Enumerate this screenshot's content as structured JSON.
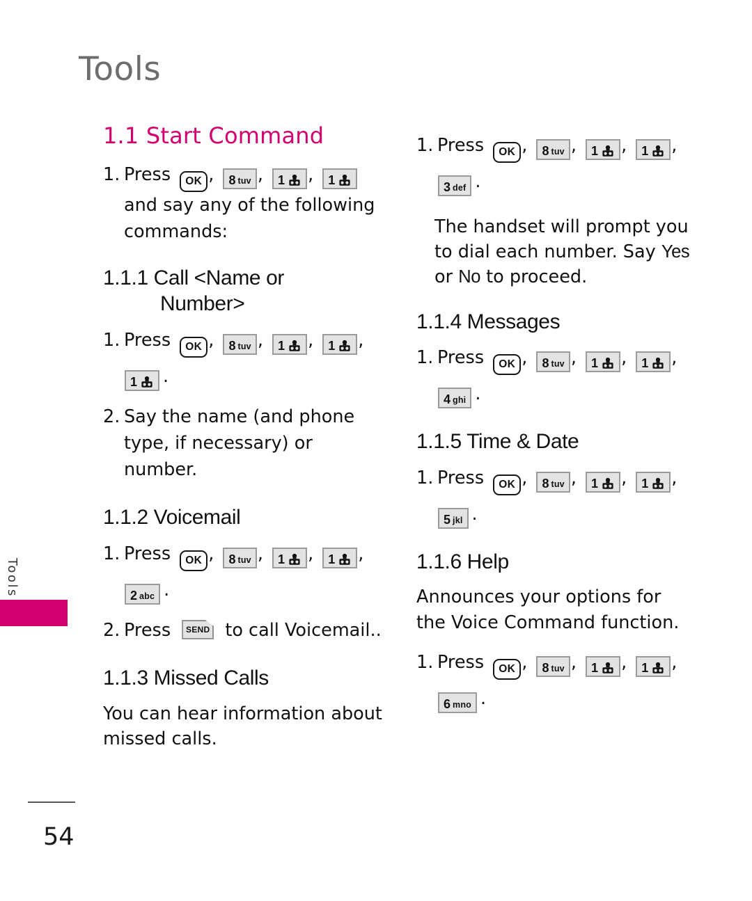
{
  "page": {
    "running_head": "Tools",
    "number": "54",
    "side_tab_label": "Tools",
    "accent_color": "#d2006e",
    "head_color": "#6d6d6d"
  },
  "keys": {
    "ok": {
      "label": "OK",
      "icon": "ok-key-icon"
    },
    "k1": {
      "digit": "1",
      "icon": "voicemail-glyph-icon"
    },
    "k2": {
      "digit": "2",
      "letters": "abc"
    },
    "k3": {
      "digit": "3",
      "letters": "def"
    },
    "k4": {
      "digit": "4",
      "letters": "ghi"
    },
    "k5": {
      "digit": "5",
      "letters": "jkl"
    },
    "k6": {
      "digit": "6",
      "letters": "mno"
    },
    "k8": {
      "digit": "8",
      "letters": "tuv"
    },
    "send": {
      "label": "SEND",
      "icon": "send-key-icon"
    }
  },
  "left_column": {
    "section_heading": "1.1 Start Command",
    "step1": {
      "num": "1.",
      "verb": "Press",
      "continuation": "and say any of the following commands:"
    },
    "sub_1_1_1": {
      "heading_line1": "1.1.1 Call <Name or",
      "heading_line2": "Number>",
      "step1_num": "1.",
      "step1_verb": "Press",
      "step2_num": "2.",
      "step2_text": "Say the name (and phone type, if necessary) or number."
    },
    "sub_1_1_2": {
      "heading": "1.1.2 Voicemail",
      "step1_num": "1.",
      "step1_verb": "Press",
      "step2_num": "2.",
      "step2_verb": "Press",
      "step2_tail": "to call Voicemail.."
    },
    "sub_1_1_3": {
      "heading": "1.1.3 Missed Calls",
      "body": "You can hear information about missed calls."
    }
  },
  "right_column": {
    "step1": {
      "num": "1.",
      "verb": "Press"
    },
    "note": {
      "line1": "The handset will prompt you",
      "line2_a": "to dial each number. Say ",
      "line2_yes": "Yes",
      "line3_a": "or ",
      "line3_no": "No",
      "line3_b": " to proceed."
    },
    "sub_1_1_4": {
      "heading": "1.1.4 Messages",
      "step1_num": "1.",
      "step1_verb": "Press"
    },
    "sub_1_1_5": {
      "heading": "1.1.5 Time & Date",
      "step1_num": "1.",
      "step1_verb": "Press"
    },
    "sub_1_1_6": {
      "heading": "1.1.6 Help",
      "body": "Announces your options for the Voice Command function.",
      "step1_num": "1.",
      "step1_verb": "Press"
    }
  },
  "punctuation": {
    "comma": ",",
    "period": "."
  }
}
